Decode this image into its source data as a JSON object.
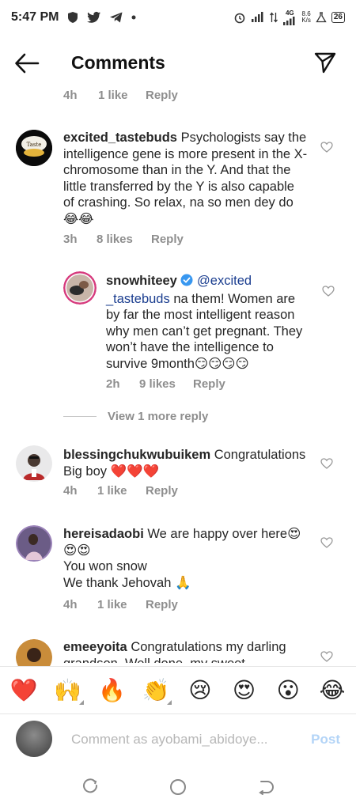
{
  "status_bar": {
    "time": "5:47 PM",
    "network": "4G",
    "speed_value": "8.6",
    "speed_unit": "K/s",
    "battery": "26"
  },
  "header": {
    "title": "Comments",
    "back_icon": "arrow-left-icon",
    "send_icon": "paper-plane-icon"
  },
  "top_meta": {
    "time": "4h",
    "likes": "1 like",
    "reply": "Reply"
  },
  "comments": [
    {
      "username": "excited_tastebuds",
      "text": "Psychologists say the intelligence gene is more present in the X-chromosome than in the Y. And that the little transferred by the Y is also capable of crashing. So relax, na so men dey do😂😂",
      "time": "3h",
      "likes": "8 likes",
      "reply": "Reply"
    },
    {
      "username": "snowhiteey",
      "mention": "@excited _tastebuds",
      "text": "na them! Women are by far the most intelligent reason why men can’t get pregnant. They won’t have the intelligence to survive 9month😏😏😏😏",
      "time": "2h",
      "likes": "9 likes",
      "reply": "Reply"
    },
    {
      "username": "blessingchukwubuikem",
      "text": "Congratulations Big boy ❤️❤️❤️",
      "time": "4h",
      "likes": "1 like",
      "reply": "Reply"
    },
    {
      "username": "hereisadaobi",
      "text": "We are happy over here😍😍😍",
      "line2": "You won snow",
      "line3": "We thank Jehovah 🙏",
      "time": "4h",
      "likes": "1 like",
      "reply": "Reply"
    },
    {
      "username": "emeeyoita",
      "text": "Congratulations my darling grandson. Well done, my sweet"
    }
  ],
  "view_more": "View 1 more reply",
  "emoji_bar": [
    "❤️",
    "🙌",
    "🔥",
    "👏",
    "😢",
    "😍",
    "😮",
    "😂"
  ],
  "composer": {
    "placeholder": "Comment as ayobami_abidoye...",
    "post_label": "Post"
  },
  "colors": {
    "accent": "#0095f6",
    "post_disabled": "#b3d4f7",
    "verified": "#3897f0"
  }
}
